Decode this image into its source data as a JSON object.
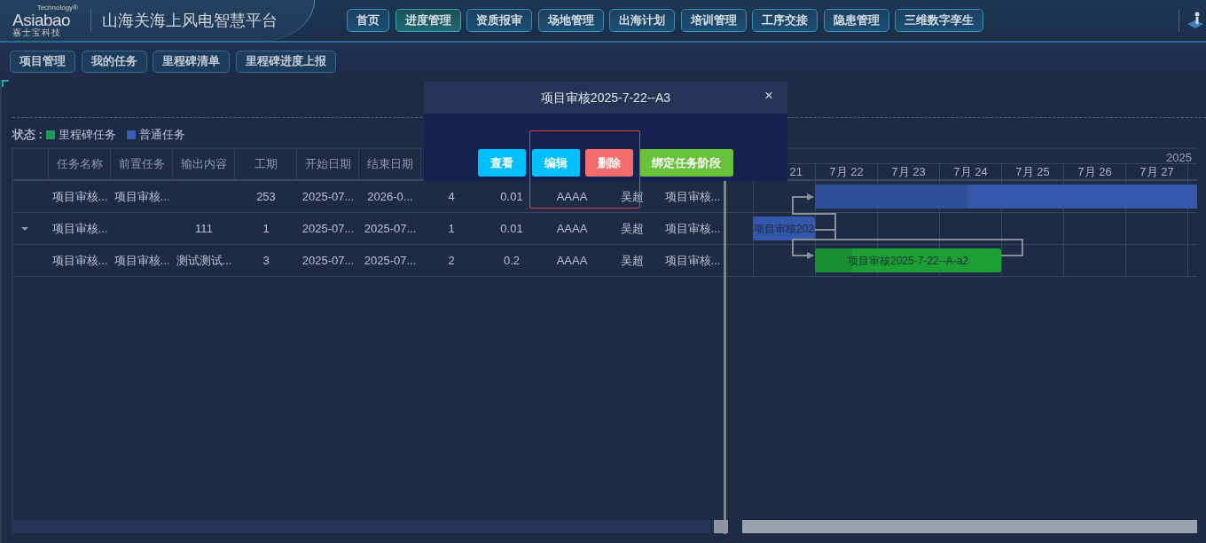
{
  "header": {
    "logo": {
      "brand": "Asiabao",
      "tagline": "Technology®",
      "subtitle": "嘉士宝科技"
    },
    "title": "山海关海上风电智慧平台",
    "nav": [
      {
        "label": "首页",
        "selected": false
      },
      {
        "label": "进度管理",
        "selected": true
      },
      {
        "label": "资质报审",
        "selected": false
      },
      {
        "label": "场地管理",
        "selected": false
      },
      {
        "label": "出海计划",
        "selected": false
      },
      {
        "label": "培训管理",
        "selected": false
      },
      {
        "label": "工序交接",
        "selected": false
      },
      {
        "label": "隐患管理",
        "selected": false
      },
      {
        "label": "三维数字孪生",
        "selected": false
      }
    ]
  },
  "subnav": [
    "项目管理",
    "我的任务",
    "里程碑清单",
    "里程碑进度上报"
  ],
  "legend": {
    "label": "状态 :",
    "items": [
      {
        "label": "里程碑任务",
        "color": "#1e9b5a"
      },
      {
        "label": "普通任务",
        "color": "#3a5dae"
      }
    ]
  },
  "table": {
    "columns": [
      "任务名称",
      "前置任务",
      "输出内容",
      "工期",
      "开始日期",
      "结束日期"
    ],
    "rows": [
      {
        "collapsible": false,
        "cells": [
          "项目审核...",
          "项目审核...",
          "",
          "253",
          "2025-07...",
          "2026-0...",
          "4",
          "0.01",
          "AAAA",
          "吴超",
          "项目审核..."
        ]
      },
      {
        "collapsible": true,
        "cells": [
          "项目审核...",
          "",
          "111",
          "1",
          "2025-07...",
          "2025-07...",
          "1",
          "0.01",
          "AAAA",
          "吴超",
          "项目审核..."
        ]
      },
      {
        "collapsible": false,
        "cells": [
          "项目审核...",
          "项目审核...",
          "测试测试...",
          "3",
          "2025-07...",
          "2025-07...",
          "2",
          "0.2",
          "AAAA",
          "吴超",
          "项目审核..."
        ]
      }
    ]
  },
  "gantt": {
    "year": "2025",
    "days": [
      "21",
      "7月 22",
      "7月 23",
      "7月 24",
      "7月 25",
      "7月 26",
      "7月 27"
    ],
    "bars": [
      {
        "kind": "normal",
        "level": 0.4
      },
      {
        "kind": "normal",
        "label": "项目审核202"
      },
      {
        "kind": "milestone",
        "label": "项目审核2025-7-22--A-a2",
        "level": 0.2
      }
    ]
  },
  "modal": {
    "title": "项目审核2025-7-22--A3",
    "close": "×",
    "buttons": [
      {
        "label": "查看",
        "kind": "info"
      },
      {
        "label": "编辑",
        "kind": "info"
      },
      {
        "label": "删除",
        "kind": "danger"
      },
      {
        "label": "绑定任务阶段",
        "kind": "success"
      }
    ]
  }
}
